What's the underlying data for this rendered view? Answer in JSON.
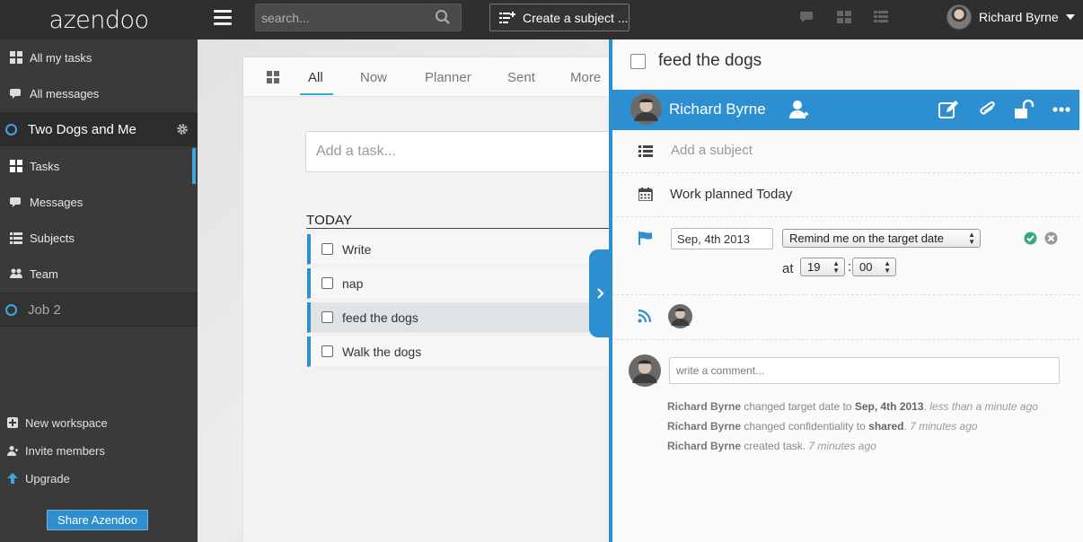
{
  "app": {
    "logo": "azendoo"
  },
  "topbar": {
    "search_placeholder": "search...",
    "create_subject_label": "Create a subject ...",
    "user_name": "Richard Byrne"
  },
  "sidebar": {
    "top_items": [
      {
        "label": "All my tasks",
        "icon": "grid-icon"
      },
      {
        "label": "All messages",
        "icon": "chat-icon"
      }
    ],
    "workspace": {
      "label": "Two Dogs and Me"
    },
    "workspace_items": [
      {
        "label": "Tasks",
        "icon": "grid-icon"
      },
      {
        "label": "Messages",
        "icon": "chat-icon"
      },
      {
        "label": "Subjects",
        "icon": "list-icon"
      },
      {
        "label": "Team",
        "icon": "team-icon"
      }
    ],
    "other_workspace": {
      "label": "Job 2"
    },
    "bottom_items": [
      {
        "label": "New workspace",
        "icon": "plus-icon"
      },
      {
        "label": "Invite members",
        "icon": "add-user-icon"
      },
      {
        "label": "Upgrade",
        "icon": "arrow-up-icon"
      }
    ],
    "share_label": "Share Azendoo"
  },
  "main": {
    "tabs": [
      {
        "label": "All"
      },
      {
        "label": "Now"
      },
      {
        "label": "Planner"
      },
      {
        "label": "Sent"
      },
      {
        "label": "More"
      }
    ],
    "add_task_placeholder": "Add a task...",
    "section_title": "TODAY",
    "tasks": [
      {
        "label": "Write"
      },
      {
        "label": "nap"
      },
      {
        "label": "feed the dogs"
      },
      {
        "label": "Walk the dogs"
      }
    ]
  },
  "detail": {
    "title": "feed the dogs",
    "owner": "Richard Byrne",
    "subject_placeholder": "Add a subject",
    "planned": "Work planned Today",
    "target_date": "Sep, 4th 2013",
    "remind_option": "Remind me on the target date",
    "at_label": "at",
    "hour": "19",
    "minute": "00",
    "comment_placeholder": "write a comment...",
    "activity": [
      {
        "user": "Richard Byrne",
        "action": "changed target date to",
        "value": "Sep, 4th 2013",
        "time": "less than a minute ago"
      },
      {
        "user": "Richard Byrne",
        "action": "changed confidentiality to",
        "value": "shared",
        "time": "7 minutes ago"
      },
      {
        "user": "Richard Byrne",
        "action": "created task.",
        "value": "",
        "time": "7 minutes ago"
      }
    ]
  },
  "colors": {
    "accent": "#2d8fd0",
    "topbar": "#2f2f2f",
    "sidebar": "#3a3a3a",
    "success": "#3aa87a"
  }
}
